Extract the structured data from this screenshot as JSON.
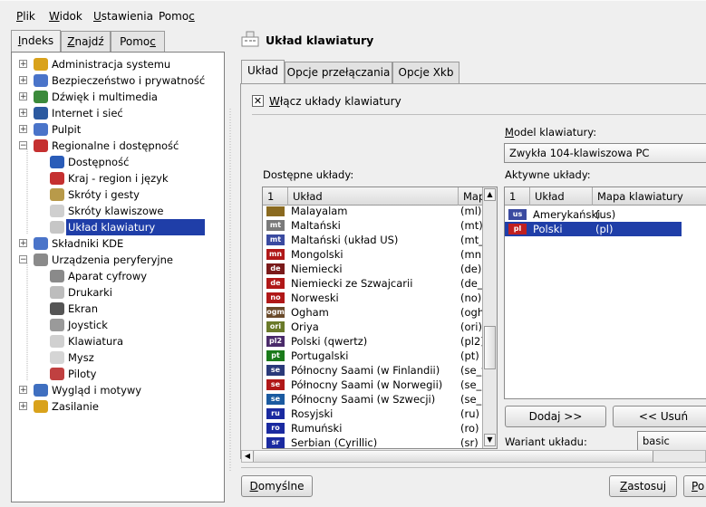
{
  "menu": [
    {
      "pre": "",
      "u": "P",
      "post": "lik"
    },
    {
      "pre": "",
      "u": "W",
      "post": "idok"
    },
    {
      "pre": "",
      "u": "U",
      "post": "stawienia"
    },
    {
      "pre": "Pomo",
      "u": "c",
      "post": ""
    }
  ],
  "left_tabs": [
    {
      "pre": "",
      "u": "I",
      "post": "ndeks"
    },
    {
      "pre": "",
      "u": "Z",
      "post": "najdź"
    },
    {
      "pre": "Pomo",
      "u": "c",
      "post": ""
    }
  ],
  "tree": [
    {
      "label": "Administracja systemu",
      "expander": "+",
      "depth": 0,
      "icon": "admin-icon",
      "color": "#d9a21b"
    },
    {
      "label": "Bezpieczeństwo i prywatność",
      "expander": "+",
      "depth": 0,
      "icon": "person-icon",
      "color": "#4a74c9"
    },
    {
      "label": "Dźwięk i multimedia",
      "expander": "+",
      "depth": 0,
      "icon": "sound-icon",
      "color": "#3b8a3b"
    },
    {
      "label": "Internet i sieć",
      "expander": "+",
      "depth": 0,
      "icon": "globe-icon",
      "color": "#2c5aa0"
    },
    {
      "label": "Pulpit",
      "expander": "+",
      "depth": 0,
      "icon": "desktop-icon",
      "color": "#4a74c9"
    },
    {
      "label": "Regionalne i dostępność",
      "expander": "−",
      "depth": 0,
      "icon": "flags-icon",
      "color": "#c53030"
    },
    {
      "label": "Dostępność",
      "expander": "",
      "depth": 1,
      "icon": "accessibility-icon",
      "color": "#2a5cb8"
    },
    {
      "label": "Kraj - region i język",
      "expander": "",
      "depth": 1,
      "icon": "flags-icon",
      "color": "#c53030"
    },
    {
      "label": "Skróty i gesty",
      "expander": "",
      "depth": 1,
      "icon": "keyboard-icon",
      "color": "#b89a4a"
    },
    {
      "label": "Skróty klawiszowe",
      "expander": "",
      "depth": 1,
      "icon": "keyboard-icon",
      "color": "#cfcfcf"
    },
    {
      "label": "Układ klawiatury",
      "expander": "",
      "depth": 1,
      "icon": "keyboard-layout-icon",
      "color": "#c6c6c6",
      "selected": true
    },
    {
      "label": "Składniki KDE",
      "expander": "+",
      "depth": 0,
      "icon": "components-icon",
      "color": "#4a74c9"
    },
    {
      "label": "Urządzenia peryferyjne",
      "expander": "−",
      "depth": 0,
      "icon": "peripherals-icon",
      "color": "#8a8a8a"
    },
    {
      "label": "Aparat cyfrowy",
      "expander": "",
      "depth": 1,
      "icon": "camera-icon",
      "color": "#8a8a8a"
    },
    {
      "label": "Drukarki",
      "expander": "",
      "depth": 1,
      "icon": "printer-icon",
      "color": "#bdbdbd"
    },
    {
      "label": "Ekran",
      "expander": "",
      "depth": 1,
      "icon": "monitor-icon",
      "color": "#555555"
    },
    {
      "label": "Joystick",
      "expander": "",
      "depth": 1,
      "icon": "joystick-icon",
      "color": "#9a9a9a"
    },
    {
      "label": "Klawiatura",
      "expander": "",
      "depth": 1,
      "icon": "keyboard-icon",
      "color": "#d0d0d0"
    },
    {
      "label": "Mysz",
      "expander": "",
      "depth": 1,
      "icon": "mouse-icon",
      "color": "#d5d5d5"
    },
    {
      "label": "Piloty",
      "expander": "",
      "depth": 1,
      "icon": "remote-icon",
      "color": "#c04040"
    },
    {
      "label": "Wygląd i motywy",
      "expander": "+",
      "depth": 0,
      "icon": "appearance-icon",
      "color": "#3f6fc0"
    },
    {
      "label": "Zasilanie",
      "expander": "+",
      "depth": 0,
      "icon": "power-icon",
      "color": "#d9a21b"
    }
  ],
  "page_title": "Układ klawiatury",
  "right_tabs": [
    "Układ",
    "Opcje przełączania",
    "Opcje Xkb"
  ],
  "enable_checkbox": {
    "pre": "",
    "u": "W",
    "post": "łącz układy klawiatury",
    "checked": "✕"
  },
  "model_label": {
    "pre": "",
    "u": "M",
    "post": "odel klawiatury:"
  },
  "model_value": "Zwykła 104-klawiszowa PC",
  "available_label": "Dostępne układy:",
  "active_label": "Aktywne układy:",
  "available_headers": [
    "1",
    "Układ",
    "Mapa"
  ],
  "available": [
    {
      "flag": "",
      "code": "ml",
      "label": "Malayalam",
      "map": "(ml)",
      "color": "#8a6a20",
      "partial": true
    },
    {
      "flag": "mt",
      "label": "Maltański",
      "map": "(mt)",
      "color": "#7a7a7a"
    },
    {
      "flag": "mt",
      "label": "Maltański (układ US)",
      "map": "(mt_u",
      "color": "#3a4aa0"
    },
    {
      "flag": "mn",
      "label": "Mongolski",
      "map": "(mn)",
      "color": "#b01818"
    },
    {
      "flag": "de",
      "label": "Niemiecki",
      "map": "(de)",
      "color": "#7a1a1a"
    },
    {
      "flag": "de",
      "label": "Niemiecki ze Szwajcarii",
      "map": "(de_c",
      "color": "#b01818"
    },
    {
      "flag": "no",
      "label": "Norweski",
      "map": "(no)",
      "color": "#b01818"
    },
    {
      "flag": "ogm",
      "label": "Ogham",
      "map": "(ogha",
      "color": "#6a4a2a"
    },
    {
      "flag": "ori",
      "label": "Oriya",
      "map": "(ori)",
      "color": "#6a7a2a"
    },
    {
      "flag": "pl2",
      "label": "Polski (qwertz)",
      "map": "(pl2)",
      "color": "#4a2a6a"
    },
    {
      "flag": "pt",
      "label": "Portugalski",
      "map": "(pt)",
      "color": "#1a7a1a"
    },
    {
      "flag": "se",
      "label": "Północny Saami (w Finlandii)",
      "map": "(se_f",
      "color": "#2a3a7a"
    },
    {
      "flag": "se",
      "label": "Północny Saami (w Norwegii)",
      "map": "(se_N",
      "color": "#b01818"
    },
    {
      "flag": "se",
      "label": "Północny Saami (w Szwecji)",
      "map": "(se_S",
      "color": "#1a5aa0"
    },
    {
      "flag": "ru",
      "label": "Rosyjski",
      "map": "(ru)",
      "color": "#1a2aa0"
    },
    {
      "flag": "ro",
      "label": "Rumuński",
      "map": "(ro)",
      "color": "#1a2aa0"
    },
    {
      "flag": "sr",
      "label": "Serbian (Cyrillic)",
      "map": "(sr)",
      "color": "#1a2aa0",
      "partial": true
    }
  ],
  "active_headers": [
    "1",
    "Układ",
    "Mapa klawiatury"
  ],
  "active": [
    {
      "flag": "us",
      "label": "Amerykański",
      "map": "(us)",
      "color": "#3a4aa0",
      "selected": false
    },
    {
      "flag": "pl",
      "label": "Polski",
      "map": "(pl)",
      "color": "#c02020",
      "selected": true
    }
  ],
  "add_button": "Dodaj >>",
  "remove_button": "<< Usuń",
  "variant_label": "Wariant układu:",
  "variant_value": "basic",
  "defaults_button": {
    "pre": "",
    "u": "D",
    "post": "omyślne"
  },
  "apply_button": {
    "pre": "",
    "u": "Z",
    "post": "astosuj"
  },
  "cut_button": {
    "pre": "",
    "u": "P",
    "post": "o"
  }
}
